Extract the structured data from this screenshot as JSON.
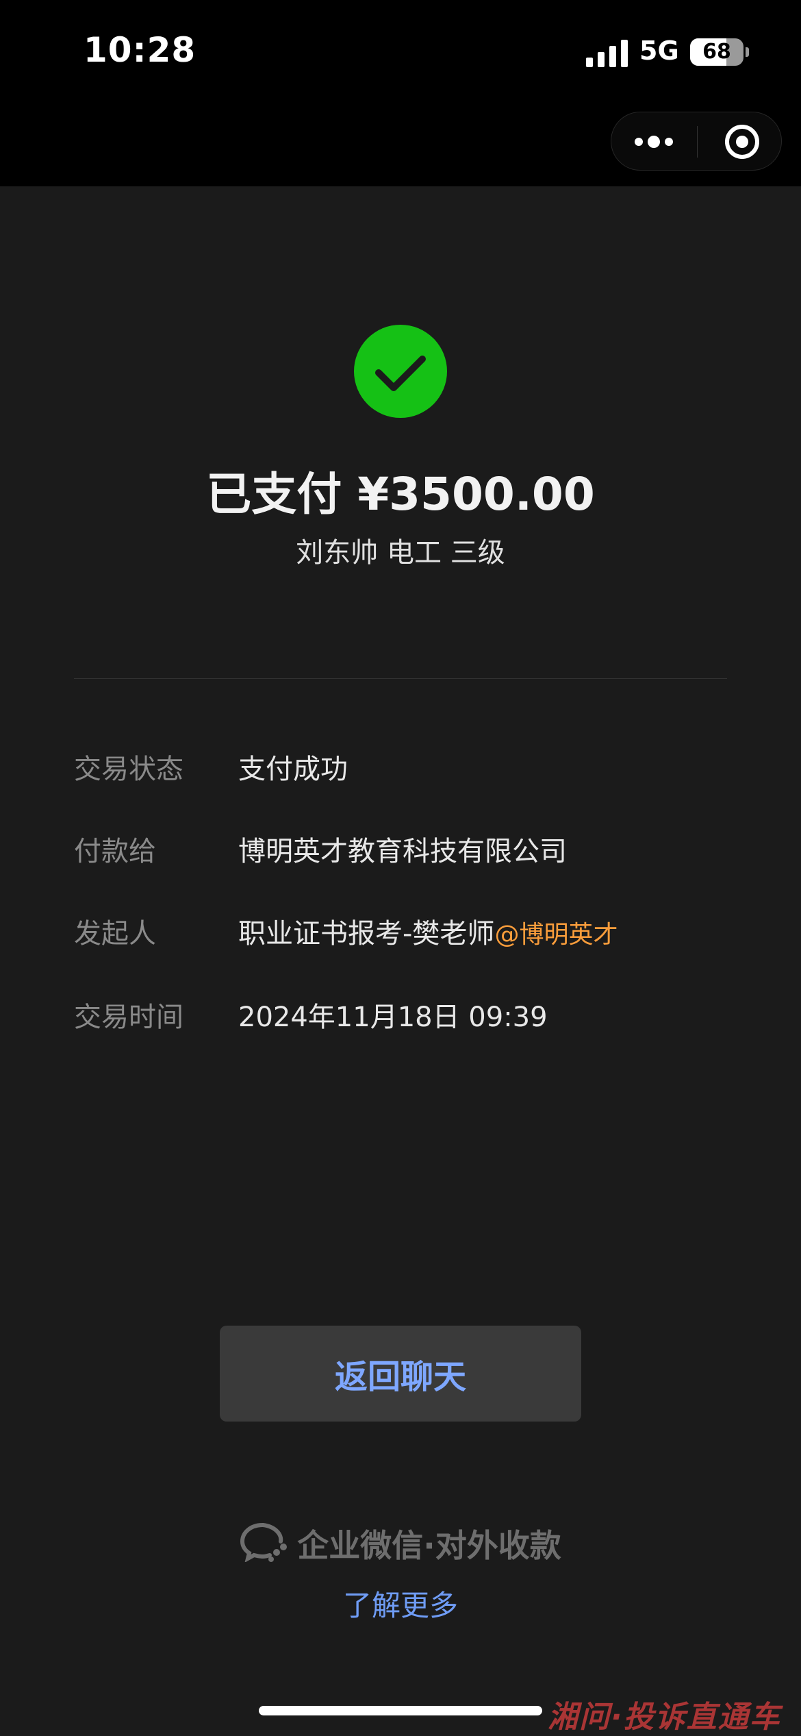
{
  "status_bar": {
    "time": "10:28",
    "network": "5G",
    "battery": "68",
    "battery_level": 0.68
  },
  "nav": {
    "more_icon": "more-dots-icon",
    "close_icon": "target-circle-icon"
  },
  "payment": {
    "status_icon": "check-circle-icon",
    "amount_text": "已支付 ¥3500.00",
    "product": "刘东帅 电工 三级"
  },
  "details": [
    {
      "label": "交易状态",
      "value": "支付成功",
      "accent": ""
    },
    {
      "label": "付款给",
      "value": "博明英才教育科技有限公司",
      "accent": ""
    },
    {
      "label": "发起人",
      "value": "职业证书报考-樊老师",
      "accent": "@博明英才"
    },
    {
      "label": "交易时间",
      "value": "2024年11月18日 09:39",
      "accent": ""
    }
  ],
  "actions": {
    "return_chat": "返回聊天"
  },
  "footer": {
    "brand": "企业微信·对外收款",
    "learn_more": "了解更多"
  },
  "watermark": "湘问·投诉直通车",
  "colors": {
    "success": "#15c115",
    "accent_orange": "#fa9d3b",
    "link_blue": "#6f9cf5",
    "background": "#1b1b1b"
  }
}
